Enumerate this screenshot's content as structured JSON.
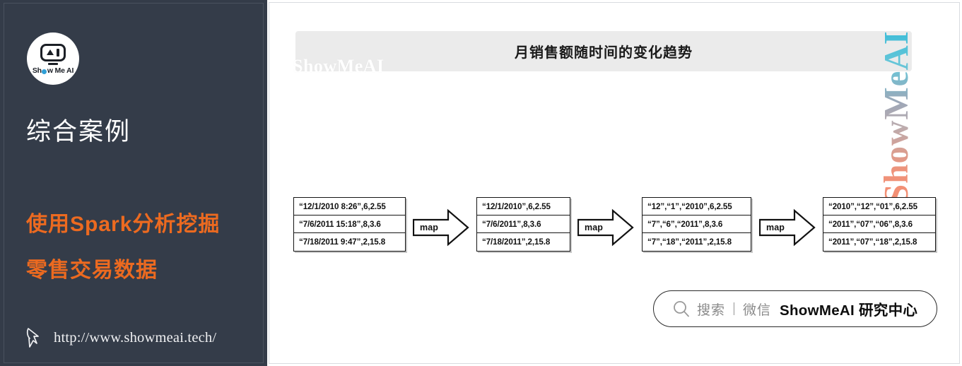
{
  "sidebar": {
    "logo": {
      "icon_name": "showmeai-robot-logo",
      "text_before": "Sh",
      "text_after": "w Me AI"
    },
    "title": "综合案例",
    "subtitle_line1": "使用Spark分析挖掘",
    "subtitle_line2": "零售交易数据",
    "url": "http://www.showmeai.tech/",
    "cursor_icon": "cursor-arrow-icon",
    "bg_color": "#343c49",
    "accent_color": "#ec6a20"
  },
  "main": {
    "header_title": "月销售额随时间的变化趋势",
    "header_watermark": "ShowMeAI",
    "side_watermark": "ShowMeAI",
    "header_bg": "#ebebeb"
  },
  "pipeline": {
    "arrow_label": "map",
    "steps": [
      {
        "name": "raw-csv-rows",
        "rows": [
          "“12/1/2010 8:26”,6,2.55",
          "“7/6/2011 15:18”,8,3.6",
          "“7/18/2011 9:47”,2,15.8"
        ]
      },
      {
        "name": "date-only-rows",
        "rows": [
          "“12/1/2010”,6,2.55",
          "“7/6/2011”,8,3.6",
          "“7/18/2011”,2,15.8"
        ]
      },
      {
        "name": "split-date-rows",
        "rows": [
          "“12”,“1”,“2010”,6,2.55",
          "“7”,“6”,“2011”,8,3.6",
          "“7”,“18”,“2011”,2,15.8"
        ]
      },
      {
        "name": "normalized-ymd-rows",
        "rows": [
          "“2010”,“12”,“01”,6,2.55",
          "“2011”,“07”,“06”,8,3.6",
          "“2011”,“07”,“18”,2,15.8"
        ]
      }
    ]
  },
  "search_pill": {
    "icon": "search-icon",
    "placeholder": "搜索",
    "divider": "|",
    "channel": "微信",
    "brand": "ShowMeAI 研究中心"
  }
}
